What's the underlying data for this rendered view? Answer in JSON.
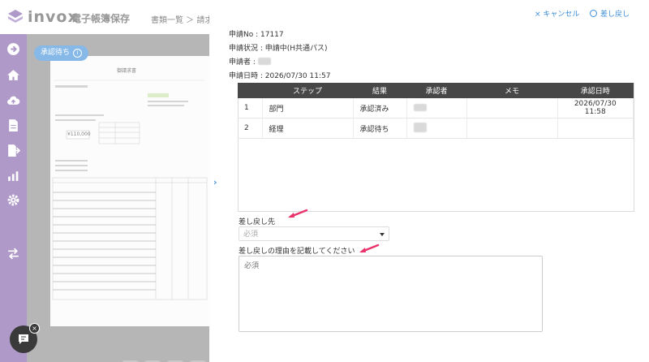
{
  "app": {
    "logo_text": "invox",
    "logo_sub": "電子帳簿保存"
  },
  "breadcrumb": "書類一覧 ＞ 請求",
  "viewer": {
    "status_label": "承認待ち",
    "status_icon": "info-icon",
    "doc_title": "御請求書",
    "doc_amount": "¥110,000",
    "tools": [
      "undo-icon",
      "redo-icon",
      "zoom-out-icon",
      "zoom-in-icon"
    ]
  },
  "nav": [
    "arrow-right-circle-icon",
    "home-icon",
    "cloud-upload-icon",
    "document-icon",
    "export-icon",
    "chart-icon",
    "gear-icon",
    "swap-icon"
  ],
  "actions": {
    "cancel": "× キャンセル",
    "reject": "差し戻し"
  },
  "info": {
    "request_no": "申請No : 17117",
    "status": "申請状況 : 申請中(H共通パス)",
    "applicant": "申請者 :",
    "date": "申請日時 : 2026/07/30 11:57"
  },
  "table": {
    "headers": [
      "",
      "ステップ",
      "結果",
      "承認者",
      "メモ",
      "承認日時"
    ],
    "rows": [
      {
        "no": "1",
        "step": "部門",
        "result": "承認済み",
        "memo": "",
        "date": "2026/07/30 11:58"
      },
      {
        "no": "2",
        "step": "経理",
        "result": "承認待ち",
        "memo": "",
        "date": ""
      }
    ]
  },
  "form": {
    "dest_label": "差し戻し先",
    "dest_placeholder": "必須",
    "reason_label": "差し戻しの理由を記載してください",
    "reason_placeholder": "必須"
  },
  "colors": {
    "accent": "#3d8ed8",
    "nav": "#7d5ba6",
    "header_row": "#474747",
    "annotation": "#e8336b"
  }
}
